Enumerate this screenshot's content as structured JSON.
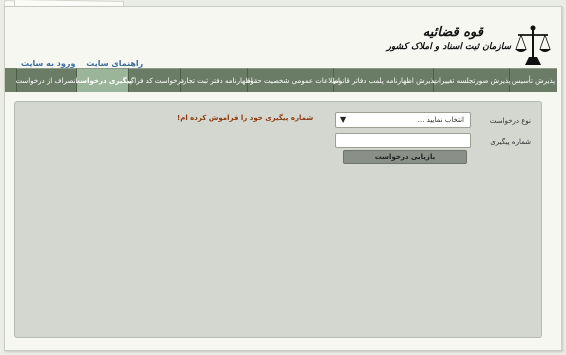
{
  "header": {
    "org_line1": "قوه قضائیه",
    "org_line2": "سازمان ثبت اسناد و املاک کشور",
    "links": [
      "راهنمای سایت",
      "ورود به سایت"
    ]
  },
  "tabs": [
    {
      "label": "پذیرش تأسیس"
    },
    {
      "label": "پذیرش صورتجلسه تغییرات"
    },
    {
      "label": "پذیرش اظهارنامه پلمب دفاتر قانونی"
    },
    {
      "label": "اطلاعات عمومی شخصیت حقوقی"
    },
    {
      "label": "اظهارنامه دفتر ثبت تجارتی"
    },
    {
      "label": "درخواست کد فراگیر"
    },
    {
      "label": "پیگیری درخواست",
      "active": true
    },
    {
      "label": "انصراف از درخواست"
    }
  ],
  "form": {
    "request_type_label": "نوع درخواست",
    "request_type_value": "انتخاب نمایید ...",
    "tracking_label": "شماره پیگیری",
    "tracking_value": "",
    "submit_label": "بازیابی درخواست",
    "forgot_link": "شماره پیگیری خود را فراموش کرده ام!"
  },
  "colors": {
    "tab_bg": "#6b7c66",
    "tab_active": "#9bb59a",
    "link_blue": "#3d6fa0",
    "forgot_link": "#8b3a10"
  }
}
